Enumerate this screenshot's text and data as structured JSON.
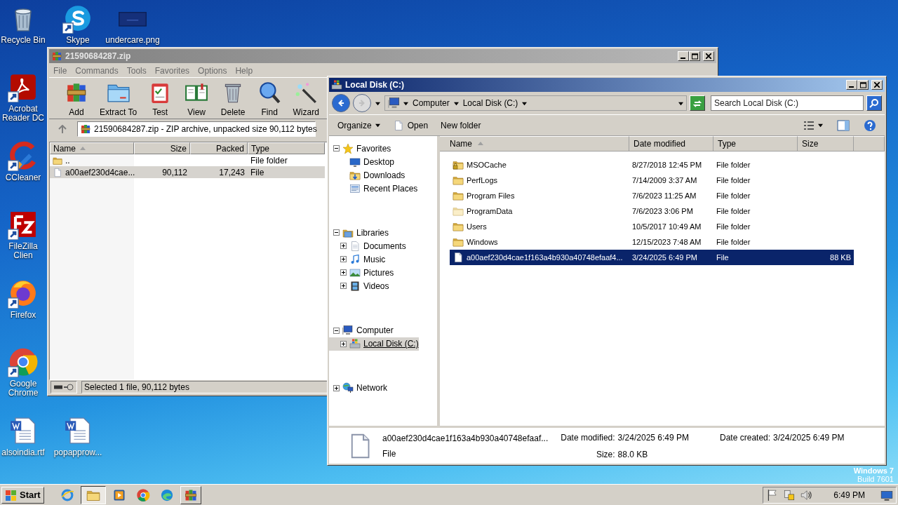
{
  "desktop": {
    "icons": [
      {
        "label": "Recycle Bin",
        "kind": "recycle",
        "shortcut": false
      },
      {
        "label": "Acrobat Reader DC",
        "kind": "acrobat",
        "shortcut": true
      },
      {
        "label": "CCleaner",
        "kind": "ccleaner",
        "shortcut": true
      },
      {
        "label": "FileZilla Clien",
        "kind": "filezilla",
        "shortcut": true
      },
      {
        "label": "Firefox",
        "kind": "firefox",
        "shortcut": true
      },
      {
        "label": "Google Chrome",
        "kind": "chrome",
        "shortcut": true
      },
      {
        "label": "alsoindia.rtf",
        "kind": "word",
        "shortcut": false
      },
      {
        "label": "Skype",
        "kind": "skype",
        "shortcut": true
      },
      {
        "label": "popapprow...",
        "kind": "word",
        "shortcut": false
      },
      {
        "label": "undercare.png",
        "kind": "image",
        "shortcut": false
      }
    ],
    "watermark": [
      "Windows 7",
      "Build 7601"
    ]
  },
  "winrar": {
    "title": "21590684287.zip",
    "menu": [
      "File",
      "Commands",
      "Tools",
      "Favorites",
      "Options",
      "Help"
    ],
    "toolbar": [
      {
        "label": "Add",
        "kind": "add"
      },
      {
        "label": "Extract To",
        "kind": "extract"
      },
      {
        "label": "Test",
        "kind": "test"
      },
      {
        "label": "View",
        "kind": "view"
      },
      {
        "label": "Delete",
        "kind": "delete"
      },
      {
        "label": "Find",
        "kind": "find"
      },
      {
        "label": "Wizard",
        "kind": "wizard"
      }
    ],
    "path": "21590684287.zip - ZIP archive, unpacked size 90,112 bytes",
    "columns": [
      {
        "label": "Name",
        "sorted": true
      },
      {
        "label": "Size",
        "sorted": false
      },
      {
        "label": "Packed",
        "sorted": false
      },
      {
        "label": "Type",
        "sorted": false
      }
    ],
    "rows": [
      {
        "name": "..",
        "type": "File folder",
        "kind": "folder",
        "selected": false
      },
      {
        "name": "a00aef230d4cae...",
        "size": "90,112",
        "packed": "17,243",
        "type": "File",
        "kind": "file",
        "selected": true
      }
    ],
    "status": "Selected 1 file, 90,112 bytes"
  },
  "explorer": {
    "title": "Local Disk (C:)",
    "nav_buttons": [
      {
        "kind": "back",
        "disabled": false
      },
      {
        "kind": "forward",
        "disabled": true
      }
    ],
    "breadcrumb": [
      "Computer",
      "Local Disk (C:)"
    ],
    "search": {
      "placeholder": "Search Local Disk (C:)"
    },
    "commands": [
      {
        "label": "Organize",
        "kind": "menu"
      },
      {
        "label": "Open",
        "kind": "open"
      },
      {
        "label": "New folder",
        "kind": "plain"
      }
    ],
    "tree": [
      {
        "label": "Favorites",
        "kind": "favorites",
        "expanded": true,
        "selected": false,
        "children": [
          {
            "label": "Desktop",
            "kind": "desktop",
            "selected": false
          },
          {
            "label": "Downloads",
            "kind": "downloads",
            "selected": false
          },
          {
            "label": "Recent Places",
            "kind": "recent",
            "selected": false
          }
        ]
      },
      {
        "label": "Libraries",
        "kind": "libraries",
        "expanded": true,
        "selected": false,
        "children": [
          {
            "label": "Documents",
            "kind": "documents",
            "expanded": false,
            "selected": false
          },
          {
            "label": "Music",
            "kind": "music",
            "expanded": false,
            "selected": false
          },
          {
            "label": "Pictures",
            "kind": "pictures",
            "expanded": false,
            "selected": false
          },
          {
            "label": "Videos",
            "kind": "videos",
            "expanded": false,
            "selected": false
          }
        ]
      },
      {
        "label": "Computer",
        "kind": "computer",
        "expanded": true,
        "selected": false,
        "children": [
          {
            "label": "Local Disk (C:)",
            "kind": "drive",
            "expanded": false,
            "selected": true
          }
        ]
      },
      {
        "label": "Network",
        "kind": "network",
        "expanded": false,
        "selected": false
      }
    ],
    "columns": [
      {
        "label": "Name",
        "sorted": true
      },
      {
        "label": "Date modified",
        "sorted": false
      },
      {
        "label": "Type",
        "sorted": false
      },
      {
        "label": "Size",
        "sorted": false
      }
    ],
    "files": [
      {
        "name": "MSOCache",
        "date": "8/27/2018 12:45 PM",
        "type": "File folder",
        "kind": "locked-folder",
        "selected": false
      },
      {
        "name": "PerfLogs",
        "date": "7/14/2009 3:37 AM",
        "type": "File folder",
        "kind": "folder",
        "selected": false
      },
      {
        "name": "Program Files",
        "date": "7/6/2023 11:25 AM",
        "type": "File folder",
        "kind": "folder",
        "selected": false
      },
      {
        "name": "ProgramData",
        "date": "7/6/2023 3:06 PM",
        "type": "File folder",
        "kind": "hidden-folder",
        "selected": false
      },
      {
        "name": "Users",
        "date": "10/5/2017 10:49 AM",
        "type": "File folder",
        "kind": "folder",
        "selected": false
      },
      {
        "name": "Windows",
        "date": "12/15/2023 7:48 AM",
        "type": "File folder",
        "kind": "folder",
        "selected": false
      },
      {
        "name": "a00aef230d4cae1f163a4b930a40748efaaf4...",
        "date": "3/24/2025 6:49 PM",
        "type": "File",
        "size": "88 KB",
        "kind": "file",
        "selected": true
      }
    ],
    "details": {
      "name": "a00aef230d4cae1f163a4b930a40748efaaf...",
      "type": "File",
      "fields": [
        {
          "label": "Date modified:",
          "value": "3/24/2025 6:49 PM"
        },
        {
          "label": "Size:",
          "value": "88.0 KB"
        },
        {
          "label": "Date created:",
          "value": "3/24/2025 6:49 PM"
        }
      ]
    }
  },
  "taskbar": {
    "start": "Start",
    "items": [
      {
        "kind": "ie",
        "selected": false,
        "running": false
      },
      {
        "kind": "explorer",
        "selected": true,
        "running": true
      },
      {
        "kind": "media",
        "selected": false,
        "running": false
      },
      {
        "kind": "chrome",
        "selected": false,
        "running": false
      },
      {
        "kind": "edge",
        "selected": false,
        "running": false
      },
      {
        "kind": "winrar",
        "selected": false,
        "running": true
      }
    ],
    "time": "6:49 PM"
  }
}
